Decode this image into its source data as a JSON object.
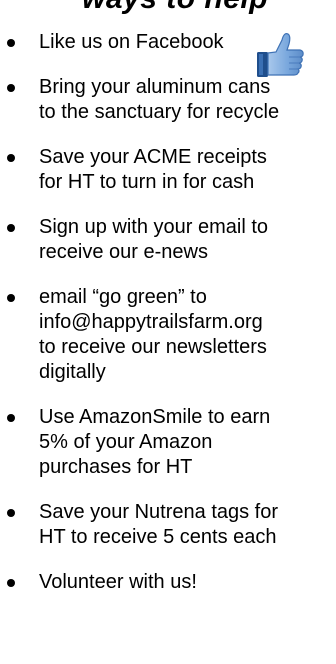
{
  "heading_fragment": "ways to help",
  "items": [
    {
      "lines": [
        "Like us on Facebook"
      ]
    },
    {
      "lines": [
        "Bring your aluminum cans",
        "to the sanctuary for recycle"
      ]
    },
    {
      "lines": [
        "Save your ACME receipts",
        "for HT to turn in for cash"
      ]
    },
    {
      "lines": [
        "Sign up with your email to",
        "receive our e-news"
      ]
    },
    {
      "lines": [
        "email  “go green” to",
        "info@happytrailsfarm.org",
        "to receive  our newsletters",
        "digitally"
      ]
    },
    {
      "lines": [
        "Use AmazonSmile to earn",
        "5% of your Amazon",
        "purchases for HT"
      ]
    },
    {
      "lines": [
        "Save your Nutrena tags for",
        "HT to receive 5 cents each"
      ]
    },
    {
      "lines": [
        "Volunteer with us!"
      ]
    }
  ],
  "icons": {
    "thumb": "thumbs-up-icon"
  },
  "colors": {
    "thumb_fill": "#6f9fd8",
    "thumb_dark": "#1f4e8c",
    "text": "#000000"
  }
}
